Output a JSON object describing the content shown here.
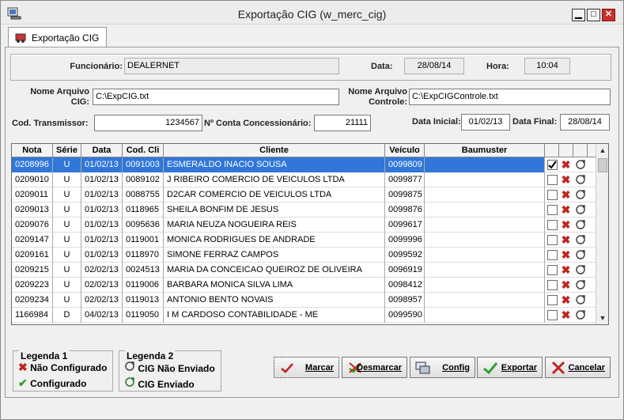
{
  "window": {
    "title": "Exportação CIG (w_merc_cig)",
    "buttons": {
      "minimize": "▁",
      "maximize": "□",
      "close": "✕"
    }
  },
  "tab": {
    "label": "Exportação CIG"
  },
  "form": {
    "funcionario_label": "Funcionário:",
    "funcionario": "DEALERNET",
    "data_label": "Data:",
    "data": "28/08/14",
    "hora_label": "Hora:",
    "hora": "10:04",
    "nome_arquivo_cig_label_1": "Nome Arquivo",
    "nome_arquivo_cig_label_2": "CIG:",
    "nome_arquivo_cig": "C:\\ExpCIG.txt",
    "nome_arquivo_ctrl_label_1": "Nome Arquivo",
    "nome_arquivo_ctrl_label_2": "Controle:",
    "nome_arquivo_ctrl": "C:\\ExpCIGControle.txt",
    "cod_transmissor_label": "Cod. Transmissor:",
    "cod_transmissor": "1234567",
    "conta_label": "Nº Conta Concessionário:",
    "conta": "21111",
    "data_inicial_label": "Data Inicial:",
    "data_inicial": "01/02/13",
    "data_final_label": "Data Final:",
    "data_final": "28/08/14"
  },
  "grid": {
    "columns": [
      "Nota",
      "Série",
      "Data",
      "Cod. Cli",
      "Cliente",
      "Veículo",
      "Baumuster"
    ],
    "rows": [
      {
        "nota": "0208996",
        "serie": "U",
        "data": "01/02/13",
        "cod_cli": "0091003",
        "cliente": "ESMERALDO INACIO SOUSA",
        "veiculo": "0099809",
        "baumuster": "",
        "checked": true
      },
      {
        "nota": "0209010",
        "serie": "U",
        "data": "01/02/13",
        "cod_cli": "0089102",
        "cliente": "J RIBEIRO COMERCIO DE VEICULOS LTDA",
        "veiculo": "0099877",
        "baumuster": "",
        "checked": false
      },
      {
        "nota": "0209011",
        "serie": "U",
        "data": "01/02/13",
        "cod_cli": "0088755",
        "cliente": "D2CAR COMERCIO DE VEICULOS LTDA",
        "veiculo": "0099875",
        "baumuster": "",
        "checked": false
      },
      {
        "nota": "0209013",
        "serie": "U",
        "data": "01/02/13",
        "cod_cli": "0118965",
        "cliente": "SHEILA BONFIM DE JESUS",
        "veiculo": "0099876",
        "baumuster": "",
        "checked": false
      },
      {
        "nota": "0209076",
        "serie": "U",
        "data": "01/02/13",
        "cod_cli": "0095636",
        "cliente": "MARIA  NEUZA NOGUEIRA REIS",
        "veiculo": "0099617",
        "baumuster": "",
        "checked": false
      },
      {
        "nota": "0209147",
        "serie": "U",
        "data": "01/02/13",
        "cod_cli": "0119001",
        "cliente": "MONICA RODRIGUES DE ANDRADE",
        "veiculo": "0099996",
        "baumuster": "",
        "checked": false
      },
      {
        "nota": "0209161",
        "serie": "U",
        "data": "01/02/13",
        "cod_cli": "0118970",
        "cliente": "SIMONE FERRAZ CAMPOS",
        "veiculo": "0099592",
        "baumuster": "",
        "checked": false
      },
      {
        "nota": "0209215",
        "serie": "U",
        "data": "02/02/13",
        "cod_cli": "0024513",
        "cliente": "MARIA DA CONCEICAO QUEIROZ DE OLIVEIRA",
        "veiculo": "0096919",
        "baumuster": "",
        "checked": false
      },
      {
        "nota": "0209223",
        "serie": "U",
        "data": "02/02/13",
        "cod_cli": "0119006",
        "cliente": "BARBARA MONICA SILVA LIMA",
        "veiculo": "0098412",
        "baumuster": "",
        "checked": false
      },
      {
        "nota": "0209234",
        "serie": "U",
        "data": "02/02/13",
        "cod_cli": "0119013",
        "cliente": "ANTONIO BENTO NOVAIS",
        "veiculo": "0098957",
        "baumuster": "",
        "checked": false
      },
      {
        "nota": "1166984",
        "serie": "D",
        "data": "04/02/13",
        "cod_cli": "0119050",
        "cliente": "I M CARDOSO CONTABILIDADE - ME",
        "veiculo": "0099590",
        "baumuster": "",
        "checked": false
      }
    ]
  },
  "legend1": {
    "title": "Legenda 1",
    "item1": "Não Configurado",
    "item2": "Configurado"
  },
  "legend2": {
    "title": "Legenda 2",
    "item1": "CIG Não Enviado",
    "item2": "CIG Enviado"
  },
  "buttons": {
    "marcar": "Marcar",
    "desmarcar": "Desmarcar",
    "config": "Config",
    "exportar": "Exportar",
    "cancelar": "Cancelar"
  },
  "colors": {
    "selection": "#3077d9",
    "red_x": "#c0261e",
    "green_check": "#2ea02e"
  }
}
